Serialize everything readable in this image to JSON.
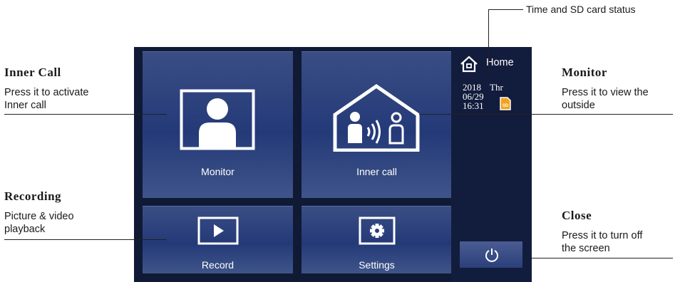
{
  "annotations": {
    "top_status": "Time and SD card status",
    "inner_call": {
      "title": "Inner Call",
      "line1": "Press it to activate",
      "line2": "Inner call"
    },
    "recording": {
      "title": "Recording",
      "line1": "Picture & video",
      "line2": "playback"
    },
    "monitor": {
      "title": "Monitor",
      "line1": "Press it to view the",
      "line2": "outside"
    },
    "close": {
      "title": "Close",
      "line1": "Press it to turn off",
      "line2": "the screen"
    }
  },
  "screen": {
    "tiles": {
      "monitor": "Monitor",
      "inner_call": "Inner call",
      "record": "Record",
      "settings": "Settings"
    },
    "side": {
      "home_label": "Home",
      "year": "2018",
      "weekday": "Thr",
      "date": "06/29",
      "time": "16:31",
      "sd_label": "SD"
    }
  },
  "icons": {
    "monitor_tile": "person-in-frame-icon",
    "inner_call_tile": "house-intercom-icon",
    "record_tile": "play-icon",
    "settings_tile": "gear-icon",
    "home": "home-icon",
    "sd": "sd-card-icon",
    "power": "power-icon"
  },
  "colors": {
    "screen_bg": "#101a35",
    "tile_blue": "#2b3f7a",
    "sd_orange": "#f3a21c"
  }
}
